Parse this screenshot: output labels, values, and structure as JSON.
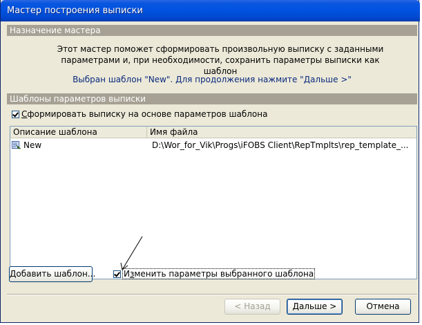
{
  "window": {
    "title": "Мастер построения выписки"
  },
  "sections": {
    "purpose_header": "Назначение мастера",
    "intro_line1": "Этот мастер поможет сформировать произвольную выписку с заданными",
    "intro_line2": "параметрами и, при необходимости, сохранить параметры выписки как шаблон",
    "selected_message": "Выбран шаблон \"New\". Для продолжения нажмите \"Дальше >\"",
    "templates_header": "Шаблоны параметров выписки"
  },
  "use_template_checkbox": {
    "label_accel": "С",
    "label_rest": "формировать выписку на основе параметров шаблона",
    "checked": true
  },
  "template_list": {
    "columns": [
      "Описание шаблона",
      "Имя файла"
    ],
    "rows": [
      {
        "description": "New",
        "file": "D:\\Wor_for_Vik\\Progs\\iFOBS Client\\RepTmplts\\rep_template_..."
      }
    ]
  },
  "add_template_button": "Добавить шаблон...",
  "edit_template_checkbox": {
    "label_pre": "И",
    "label_accel": "з",
    "label_rest": "менить параметры выбранного шаблона",
    "checked": true
  },
  "nav": {
    "back_label": "< Назад",
    "next_label_pre": "",
    "next_label_accel": "Д",
    "next_label_rest": "альше >",
    "cancel_label": "Отмена"
  },
  "colors": {
    "title_bar": "#0052e0",
    "section_header": "#a6a194",
    "selected_message": "#0a2a7e",
    "window_bg": "#ece9d8"
  }
}
